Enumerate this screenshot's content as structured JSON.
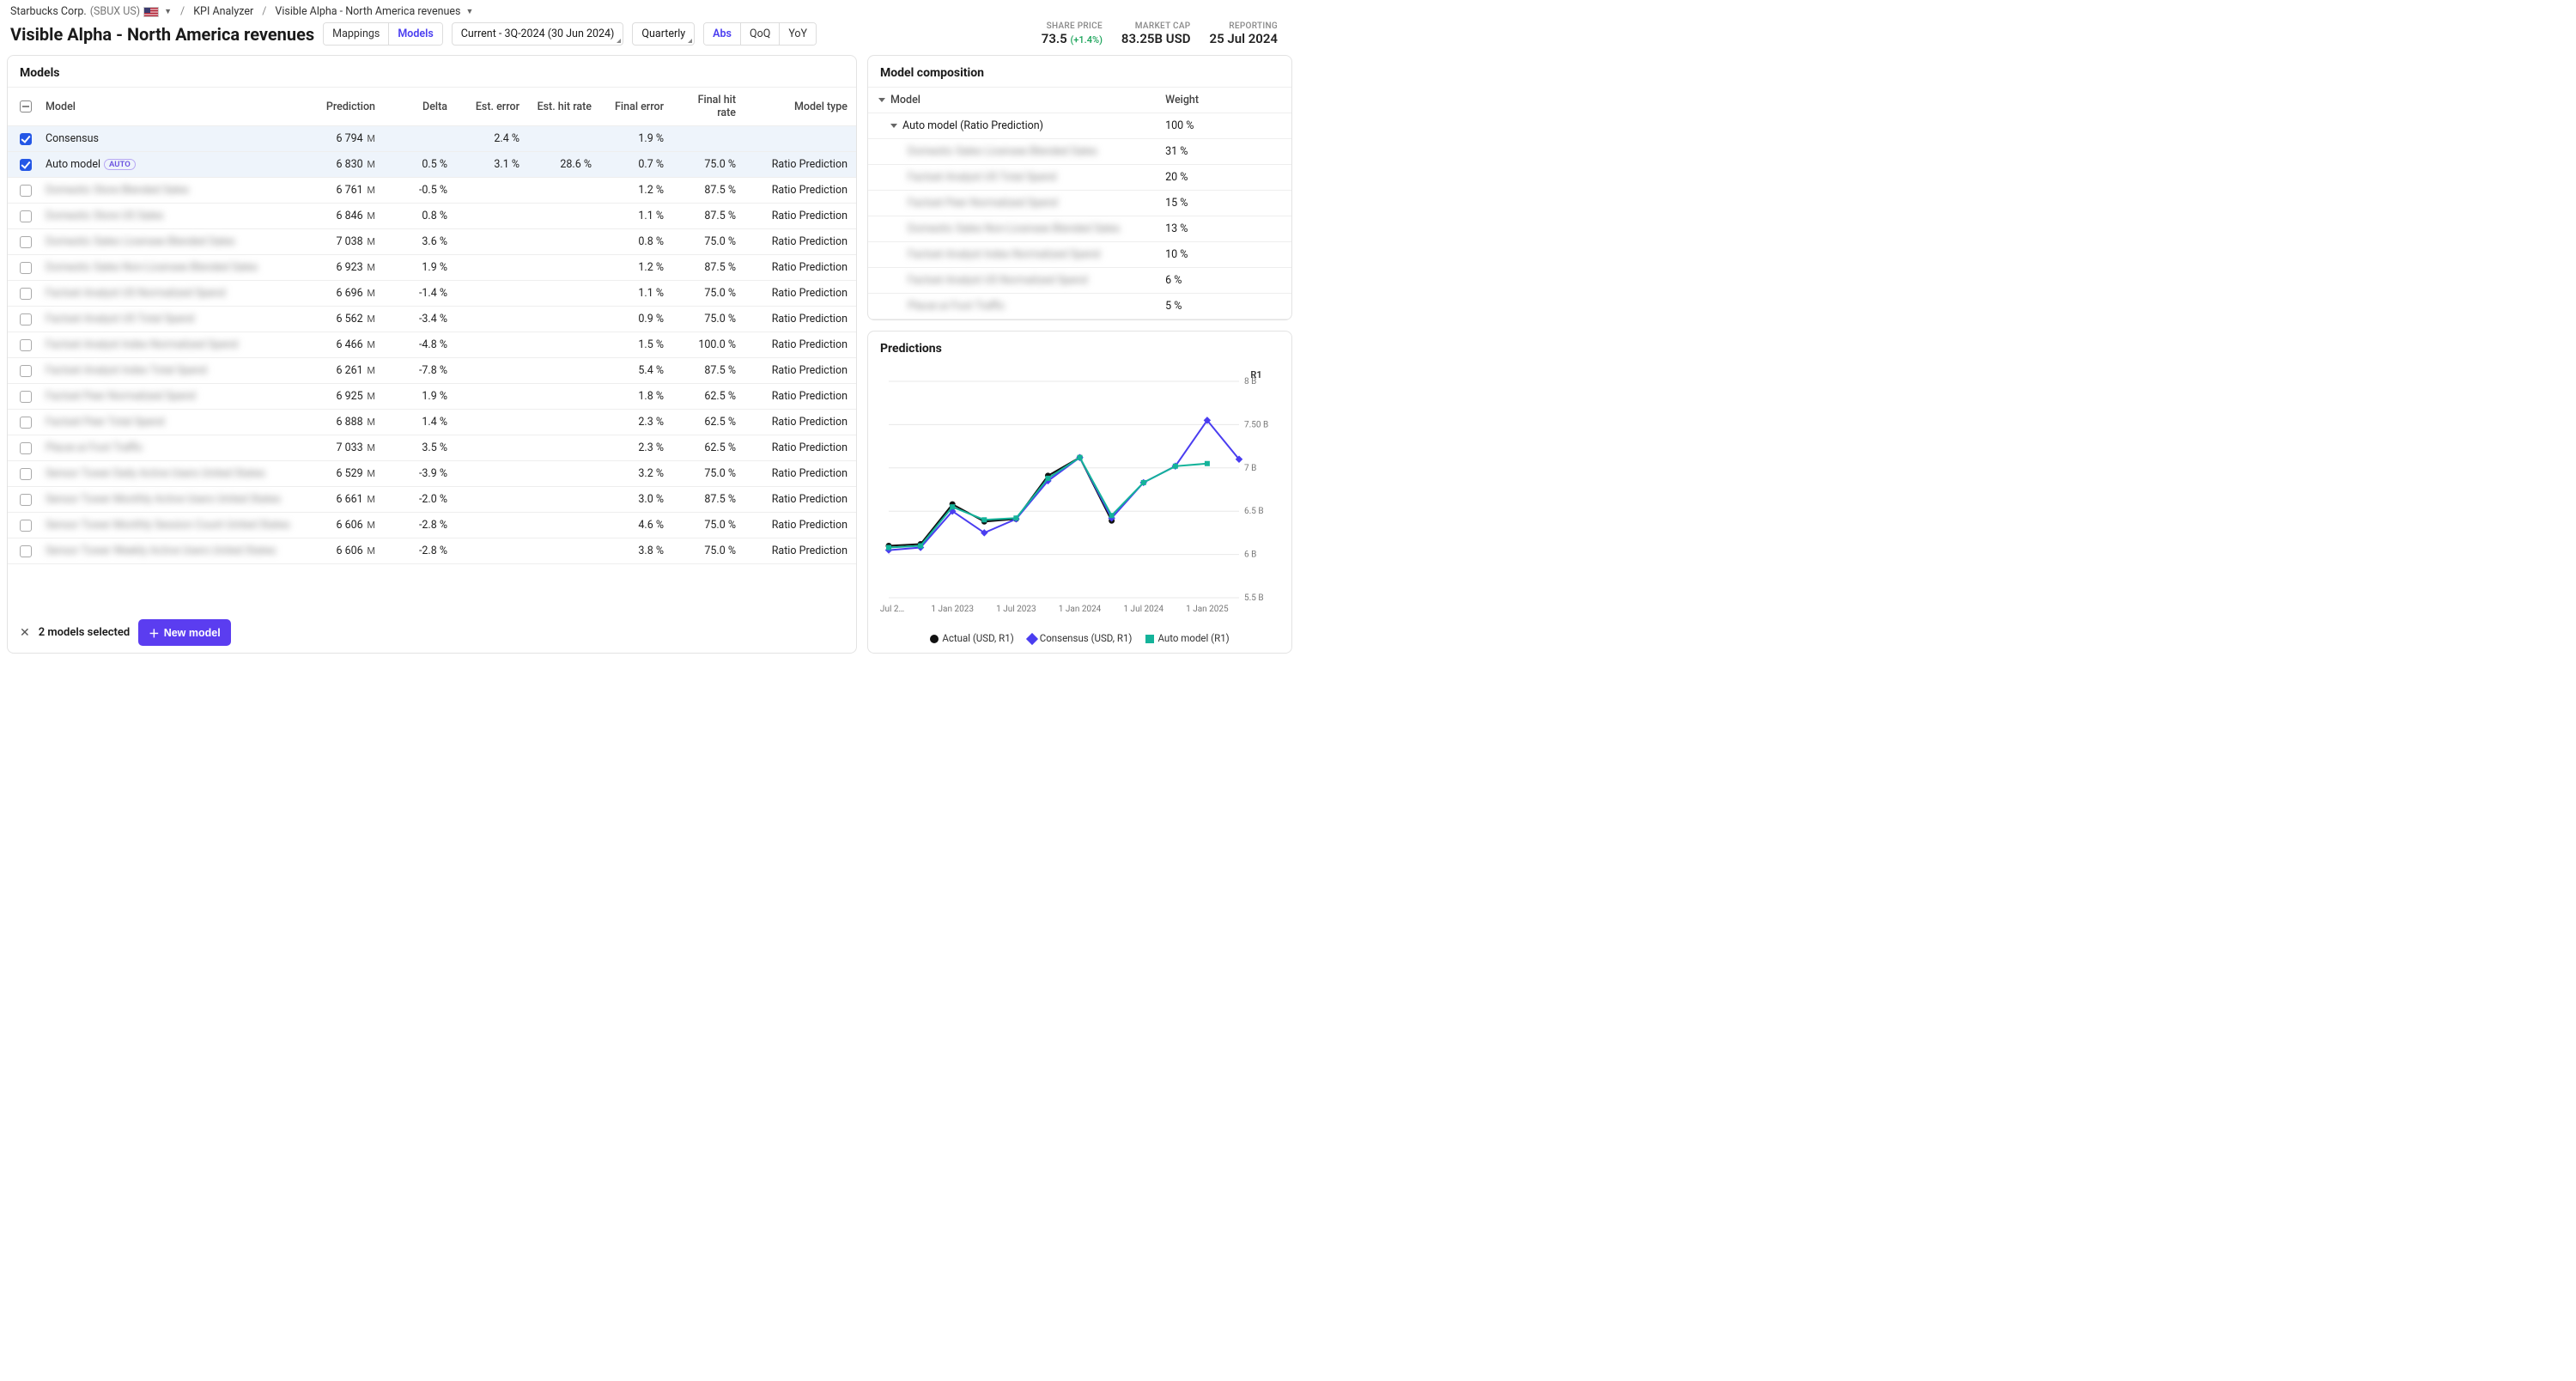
{
  "breadcrumb": {
    "company": "Starbucks Corp.",
    "ticker": "(SBUX US)",
    "section": "KPI Analyzer",
    "metric": "Visible Alpha - North America revenues"
  },
  "page_title": "Visible Alpha - North America revenues",
  "tabs_main": {
    "mappings": "Mappings",
    "models": "Models"
  },
  "period": {
    "label": "Current - 3Q-2024 (30 Jun 2024)",
    "freq": "Quarterly"
  },
  "tabs_calc": {
    "abs": "Abs",
    "qoq": "QoQ",
    "yoy": "YoY"
  },
  "header_kpis": {
    "share_price": {
      "label": "SHARE PRICE",
      "value": "73.5",
      "delta": "(+1.4%)"
    },
    "market_cap": {
      "label": "MARKET CAP",
      "value": "83.25B USD"
    },
    "reporting": {
      "label": "REPORTING",
      "value": "25 Jul 2024"
    }
  },
  "panels": {
    "models_title": "Models",
    "composition_title": "Model composition",
    "predictions_title": "Predictions"
  },
  "models_table": {
    "headers": [
      "Model",
      "Prediction",
      "Delta",
      "Est. error",
      "Est. hit rate",
      "Final error",
      "Final hit rate",
      "Model type"
    ],
    "unit": "M",
    "rows": [
      {
        "checked": true,
        "name": "Consensus",
        "blur": false,
        "pred": "6 794",
        "delta": "",
        "esterr": "2.4 %",
        "esthit": "",
        "finerr": "1.9 %",
        "finhit": "",
        "type": ""
      },
      {
        "checked": true,
        "name": "Auto model",
        "auto": true,
        "blur": false,
        "pred": "6 830",
        "delta": "0.5 %",
        "esterr": "3.1 %",
        "esthit": "28.6 %",
        "finerr": "0.7 %",
        "finhit": "75.0 %",
        "type": "Ratio Prediction"
      },
      {
        "checked": false,
        "name": "Domestic Store Blended Sales",
        "blur": true,
        "pred": "6 761",
        "delta": "-0.5 %",
        "esterr": "",
        "esthit": "",
        "finerr": "1.2 %",
        "finhit": "87.5 %",
        "type": "Ratio Prediction"
      },
      {
        "checked": false,
        "name": "Domestic Store US Sales",
        "blur": true,
        "pred": "6 846",
        "delta": "0.8 %",
        "esterr": "",
        "esthit": "",
        "finerr": "1.1 %",
        "finhit": "87.5 %",
        "type": "Ratio Prediction"
      },
      {
        "checked": false,
        "name": "Domestic Sales Licensee Blended Sales",
        "blur": true,
        "pred": "7 038",
        "delta": "3.6 %",
        "esterr": "",
        "esthit": "",
        "finerr": "0.8 %",
        "finhit": "75.0 %",
        "type": "Ratio Prediction"
      },
      {
        "checked": false,
        "name": "Domestic Sales Non-Licensee Blended Sales",
        "blur": true,
        "pred": "6 923",
        "delta": "1.9 %",
        "esterr": "",
        "esthit": "",
        "finerr": "1.2 %",
        "finhit": "87.5 %",
        "type": "Ratio Prediction"
      },
      {
        "checked": false,
        "name": "Factset Analyst US Normalized Spend",
        "blur": true,
        "pred": "6 696",
        "delta": "-1.4 %",
        "esterr": "",
        "esthit": "",
        "finerr": "1.1 %",
        "finhit": "75.0 %",
        "type": "Ratio Prediction"
      },
      {
        "checked": false,
        "name": "Factset Analyst US Total Spend",
        "blur": true,
        "pred": "6 562",
        "delta": "-3.4 %",
        "esterr": "",
        "esthit": "",
        "finerr": "0.9 %",
        "finhit": "75.0 %",
        "type": "Ratio Prediction"
      },
      {
        "checked": false,
        "name": "Factset Analyst Index Normalized Spend",
        "blur": true,
        "pred": "6 466",
        "delta": "-4.8 %",
        "esterr": "",
        "esthit": "",
        "finerr": "1.5 %",
        "finhit": "100.0 %",
        "type": "Ratio Prediction"
      },
      {
        "checked": false,
        "name": "Factset Analyst Index Total Spend",
        "blur": true,
        "pred": "6 261",
        "delta": "-7.8 %",
        "esterr": "",
        "esthit": "",
        "finerr": "5.4 %",
        "finhit": "87.5 %",
        "type": "Ratio Prediction"
      },
      {
        "checked": false,
        "name": "Factset Peer Normalized Spend",
        "blur": true,
        "pred": "6 925",
        "delta": "1.9 %",
        "esterr": "",
        "esthit": "",
        "finerr": "1.8 %",
        "finhit": "62.5 %",
        "type": "Ratio Prediction"
      },
      {
        "checked": false,
        "name": "Factset Peer Total Spend",
        "blur": true,
        "pred": "6 888",
        "delta": "1.4 %",
        "esterr": "",
        "esthit": "",
        "finerr": "2.3 %",
        "finhit": "62.5 %",
        "type": "Ratio Prediction"
      },
      {
        "checked": false,
        "name": "Placer.ai Foot Traffic",
        "blur": true,
        "pred": "7 033",
        "delta": "3.5 %",
        "esterr": "",
        "esthit": "",
        "finerr": "2.3 %",
        "finhit": "62.5 %",
        "type": "Ratio Prediction"
      },
      {
        "checked": false,
        "name": "Sensor Tower Daily Active Users United States",
        "blur": true,
        "pred": "6 529",
        "delta": "-3.9 %",
        "esterr": "",
        "esthit": "",
        "finerr": "3.2 %",
        "finhit": "75.0 %",
        "type": "Ratio Prediction"
      },
      {
        "checked": false,
        "name": "Sensor Tower Monthly Active Users United States",
        "blur": true,
        "pred": "6 661",
        "delta": "-2.0 %",
        "esterr": "",
        "esthit": "",
        "finerr": "3.0 %",
        "finhit": "87.5 %",
        "type": "Ratio Prediction"
      },
      {
        "checked": false,
        "name": "Sensor Tower Monthly Session Count United States",
        "blur": true,
        "pred": "6 606",
        "delta": "-2.8 %",
        "esterr": "",
        "esthit": "",
        "finerr": "4.6 %",
        "finhit": "75.0 %",
        "type": "Ratio Prediction"
      },
      {
        "checked": false,
        "name": "Sensor Tower Weekly Active Users United States",
        "blur": true,
        "pred": "6 606",
        "delta": "-2.8 %",
        "esterr": "",
        "esthit": "",
        "finerr": "3.8 %",
        "finhit": "75.0 %",
        "type": "Ratio Prediction"
      }
    ]
  },
  "composition_table": {
    "headers": [
      "Model",
      "Weight"
    ],
    "root": {
      "name": "Auto model (Ratio Prediction)",
      "weight": "100 %"
    },
    "children": [
      {
        "name": "Domestic Sales Licensee Blended Sales",
        "weight": "31 %"
      },
      {
        "name": "Factset Analyst US Total Spend",
        "weight": "20 %"
      },
      {
        "name": "Factset Peer Normalized Spend",
        "weight": "15 %"
      },
      {
        "name": "Domestic Sales Non-Licensee Blended Sales",
        "weight": "13 %"
      },
      {
        "name": "Factset Analyst Index Normalized Spend",
        "weight": "10 %"
      },
      {
        "name": "Factset Analyst US Normalized Spend",
        "weight": "6 %"
      },
      {
        "name": "Placer.ai Foot Traffic",
        "weight": "5 %"
      }
    ]
  },
  "footer": {
    "selection_text": "2 models selected",
    "new_model": "New model"
  },
  "chart_data": {
    "type": "line",
    "title": "Predictions",
    "r_axis_label": "R1",
    "x_ticks": [
      "1 Jul 2…",
      "1 Jan 2023",
      "1 Jul 2023",
      "1 Jan 2024",
      "1 Jul 2024",
      "1 Jan 2025"
    ],
    "y_ticks": [
      "5.5 B",
      "6 B",
      "6.5 B",
      "7 B",
      "7.50 B",
      "8 B"
    ],
    "ylim": [
      5.5,
      8.0
    ],
    "x": [
      "2022-07-01",
      "2022-10-01",
      "2023-01-01",
      "2023-04-01",
      "2023-07-01",
      "2023-10-01",
      "2024-01-01",
      "2024-04-01",
      "2024-07-01",
      "2024-10-01",
      "2025-01-01",
      "2025-04-01"
    ],
    "series": [
      {
        "name": "Actual (USD, R1)",
        "color": "#111",
        "marker": "circle",
        "values": [
          6.1,
          6.12,
          6.58,
          6.38,
          6.41,
          6.91,
          7.12,
          6.39,
          null,
          null,
          null,
          null
        ]
      },
      {
        "name": "Consensus (USD, R1)",
        "color": "#4a3df0",
        "marker": "diamond",
        "values": [
          6.05,
          6.08,
          6.5,
          6.25,
          6.41,
          6.85,
          7.12,
          6.42,
          6.83,
          7.02,
          7.55,
          7.1
        ]
      },
      {
        "name": "Auto model (R1)",
        "color": "#14b39a",
        "marker": "square",
        "values": [
          6.08,
          6.1,
          6.55,
          6.4,
          6.42,
          6.88,
          7.12,
          6.45,
          6.83,
          7.02,
          7.05,
          null
        ]
      }
    ]
  }
}
